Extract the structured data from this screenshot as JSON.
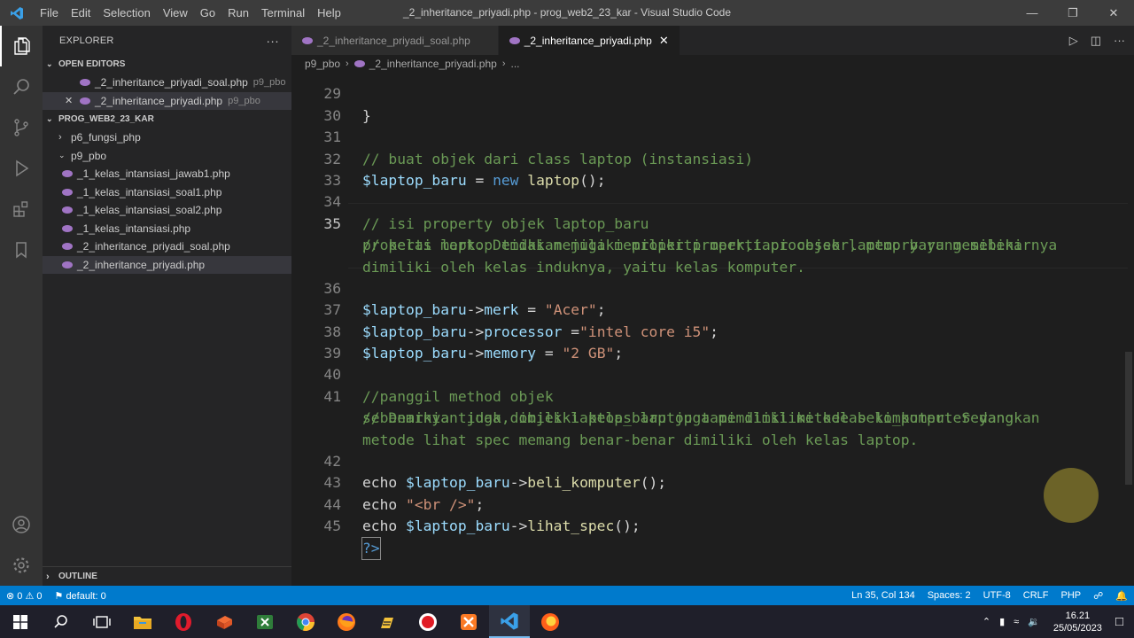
{
  "window": {
    "title": "_2_inheritance_priyadi.php - prog_web2_23_kar - Visual Studio Code",
    "menu": [
      "File",
      "Edit",
      "Selection",
      "View",
      "Go",
      "Run",
      "Terminal",
      "Help"
    ]
  },
  "sidebar": {
    "title": "EXPLORER",
    "open_editors_label": "OPEN EDITORS",
    "open_editors": [
      {
        "name": "_2_inheritance_priyadi_soal.php",
        "folder": "p9_pbo"
      },
      {
        "name": "_2_inheritance_priyadi.php",
        "folder": "p9_pbo"
      }
    ],
    "workspace_label": "PROG_WEB2_23_KAR",
    "folders": [
      "p6_fungsi_php",
      "p9_pbo"
    ],
    "files": [
      "_1_kelas_intansiasi_jawab1.php",
      "_1_kelas_intansiasi_soal1.php",
      "_1_kelas_intansiasi_soal2.php",
      "_1_kelas_intansiasi.php",
      "_2_inheritance_priyadi_soal.php",
      "_2_inheritance_priyadi.php"
    ],
    "outline_label": "OUTLINE"
  },
  "tabs": [
    {
      "label": "_2_inheritance_priyadi_soal.php"
    },
    {
      "label": "_2_inheritance_priyadi.php"
    }
  ],
  "breadcrumb": {
    "folder": "p9_pbo",
    "file": "_2_inheritance_priyadi.php",
    "more": "..."
  },
  "code": {
    "line_numbers": [
      "29",
      "30",
      "31",
      "32",
      "33",
      "34",
      "35",
      "36",
      "37",
      "38",
      "39",
      "40",
      "41",
      "42",
      "43",
      "44",
      "45"
    ],
    "l29": "}",
    "l31": "// buat objek dari class laptop (instansiasi)",
    "l32_var": "$laptop_baru",
    "l32_eq": " = ",
    "l32_new": "new",
    "l32_cls": " laptop",
    "l32_end": "();",
    "l34": "// isi property objek laptop_baru",
    "l35a": "// kelas laptop tidak memiliki properti merk,tapi objek laptop baru memiliki",
    "l35b": "properti merk. Demikian juga memiliki properti processor, memory yang sebenarnya",
    "l35c": "dimiliki oleh kelas induknya, yaitu kelas komputer.",
    "l36_var": "$laptop_baru",
    "l36_arrow": "->",
    "l36_prop": "merk",
    "l36_eq": " = ",
    "l36_str": "\"Acer\"",
    "l36_end": ";",
    "l37_var": "$laptop_baru",
    "l37_arrow": "->",
    "l37_prop": "processor",
    "l37_eq": " =",
    "l37_str": "\"intel core i5\"",
    "l37_end": ";",
    "l38_var": "$laptop_baru",
    "l38_arrow": "->",
    "l38_prop": "memory",
    "l38_eq": " = ",
    "l38_str": "\"2 GB\"",
    "l38_end": ";",
    "l40": "//panggil method objek",
    "l41a": "// Demikian juga, objek laptop_baru juga memiliki metode beli_komputer yang",
    "l41b": "sebenarnya tidak dimiliki kelas laptop tapi dimiliki kelas komputer. Sedangkan",
    "l41c": "metode lihat spec memang benar-benar dimiliki oleh kelas laptop.",
    "l42_kw": "echo",
    "l42_var": " $laptop_baru",
    "l42_arrow": "->",
    "l42_fn": "beli_komputer",
    "l42_end": "();",
    "l43_kw": "echo",
    "l43_str": " \"<br />\"",
    "l43_end": ";",
    "l44_kw": "echo",
    "l44_var": " $laptop_baru",
    "l44_arrow": "->",
    "l44_fn": "lihat_spec",
    "l44_end": "();",
    "l45": "?>"
  },
  "status": {
    "errors": "0",
    "warnings": "0",
    "branch": "default: 0",
    "position": "Ln 35, Col 134",
    "spaces": "Spaces: 2",
    "encoding": "UTF-8",
    "eol": "CRLF",
    "language": "PHP"
  },
  "taskbar": {
    "time": "16.21",
    "date": "25/05/2023"
  },
  "colors": {
    "statusbar": "#007acc",
    "comment": "#6a9955",
    "variable": "#9cdcfe",
    "keyword": "#569cd6",
    "string": "#ce9178"
  }
}
